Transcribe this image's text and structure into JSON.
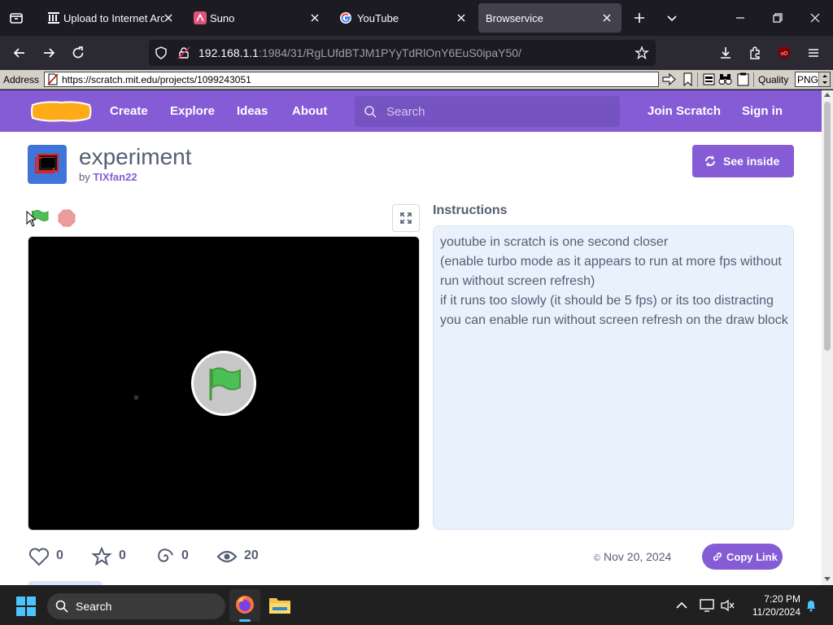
{
  "browser": {
    "tabs": [
      {
        "title": "Upload to Internet Arch",
        "active": false
      },
      {
        "title": "Suno",
        "active": false
      },
      {
        "title": "YouTube",
        "active": false
      },
      {
        "title": "Browservice",
        "active": true
      }
    ],
    "url_host": "192.168.1.1",
    "url_path": ":1984/31/RgLUfdBTJM1PYyTdRlOnY6EuS0ipaY50/"
  },
  "browservice": {
    "address_label": "Address",
    "address_value": "https://scratch.mit.edu/projects/1099243051",
    "quality_label": "Quality",
    "quality_value": "PNG"
  },
  "scratch_nav": {
    "logo": "SCRATCH",
    "links": [
      "Create",
      "Explore",
      "Ideas",
      "About"
    ],
    "search_placeholder": "Search",
    "join": "Join Scratch",
    "signin": "Sign in"
  },
  "project": {
    "title": "experiment",
    "by_label": "by",
    "author": "TIXfan22",
    "see_inside": "See inside",
    "instructions_heading": "Instructions",
    "instructions_lines": [
      "youtube in scratch is one second closer",
      "(enable turbo mode as it appears to run at more fps without",
      "run without screen refresh)",
      "if it runs too slowly (it should be 5 fps) or its too distracting",
      "you can enable run without screen refresh on the draw block"
    ],
    "stats": {
      "loves": "0",
      "favorites": "0",
      "remixes": "0",
      "views": "20"
    },
    "date": "Nov 20, 2024",
    "copy_link": "Copy Link"
  },
  "taskbar": {
    "search_placeholder": "Search",
    "time": "7:20 PM",
    "date": "11/20/2024"
  },
  "colors": {
    "scratch_purple": "#855cd6",
    "instructions_bg": "#e9f1fc",
    "flag_green": "#4cbf56",
    "stop_red": "#ec9c9c"
  }
}
